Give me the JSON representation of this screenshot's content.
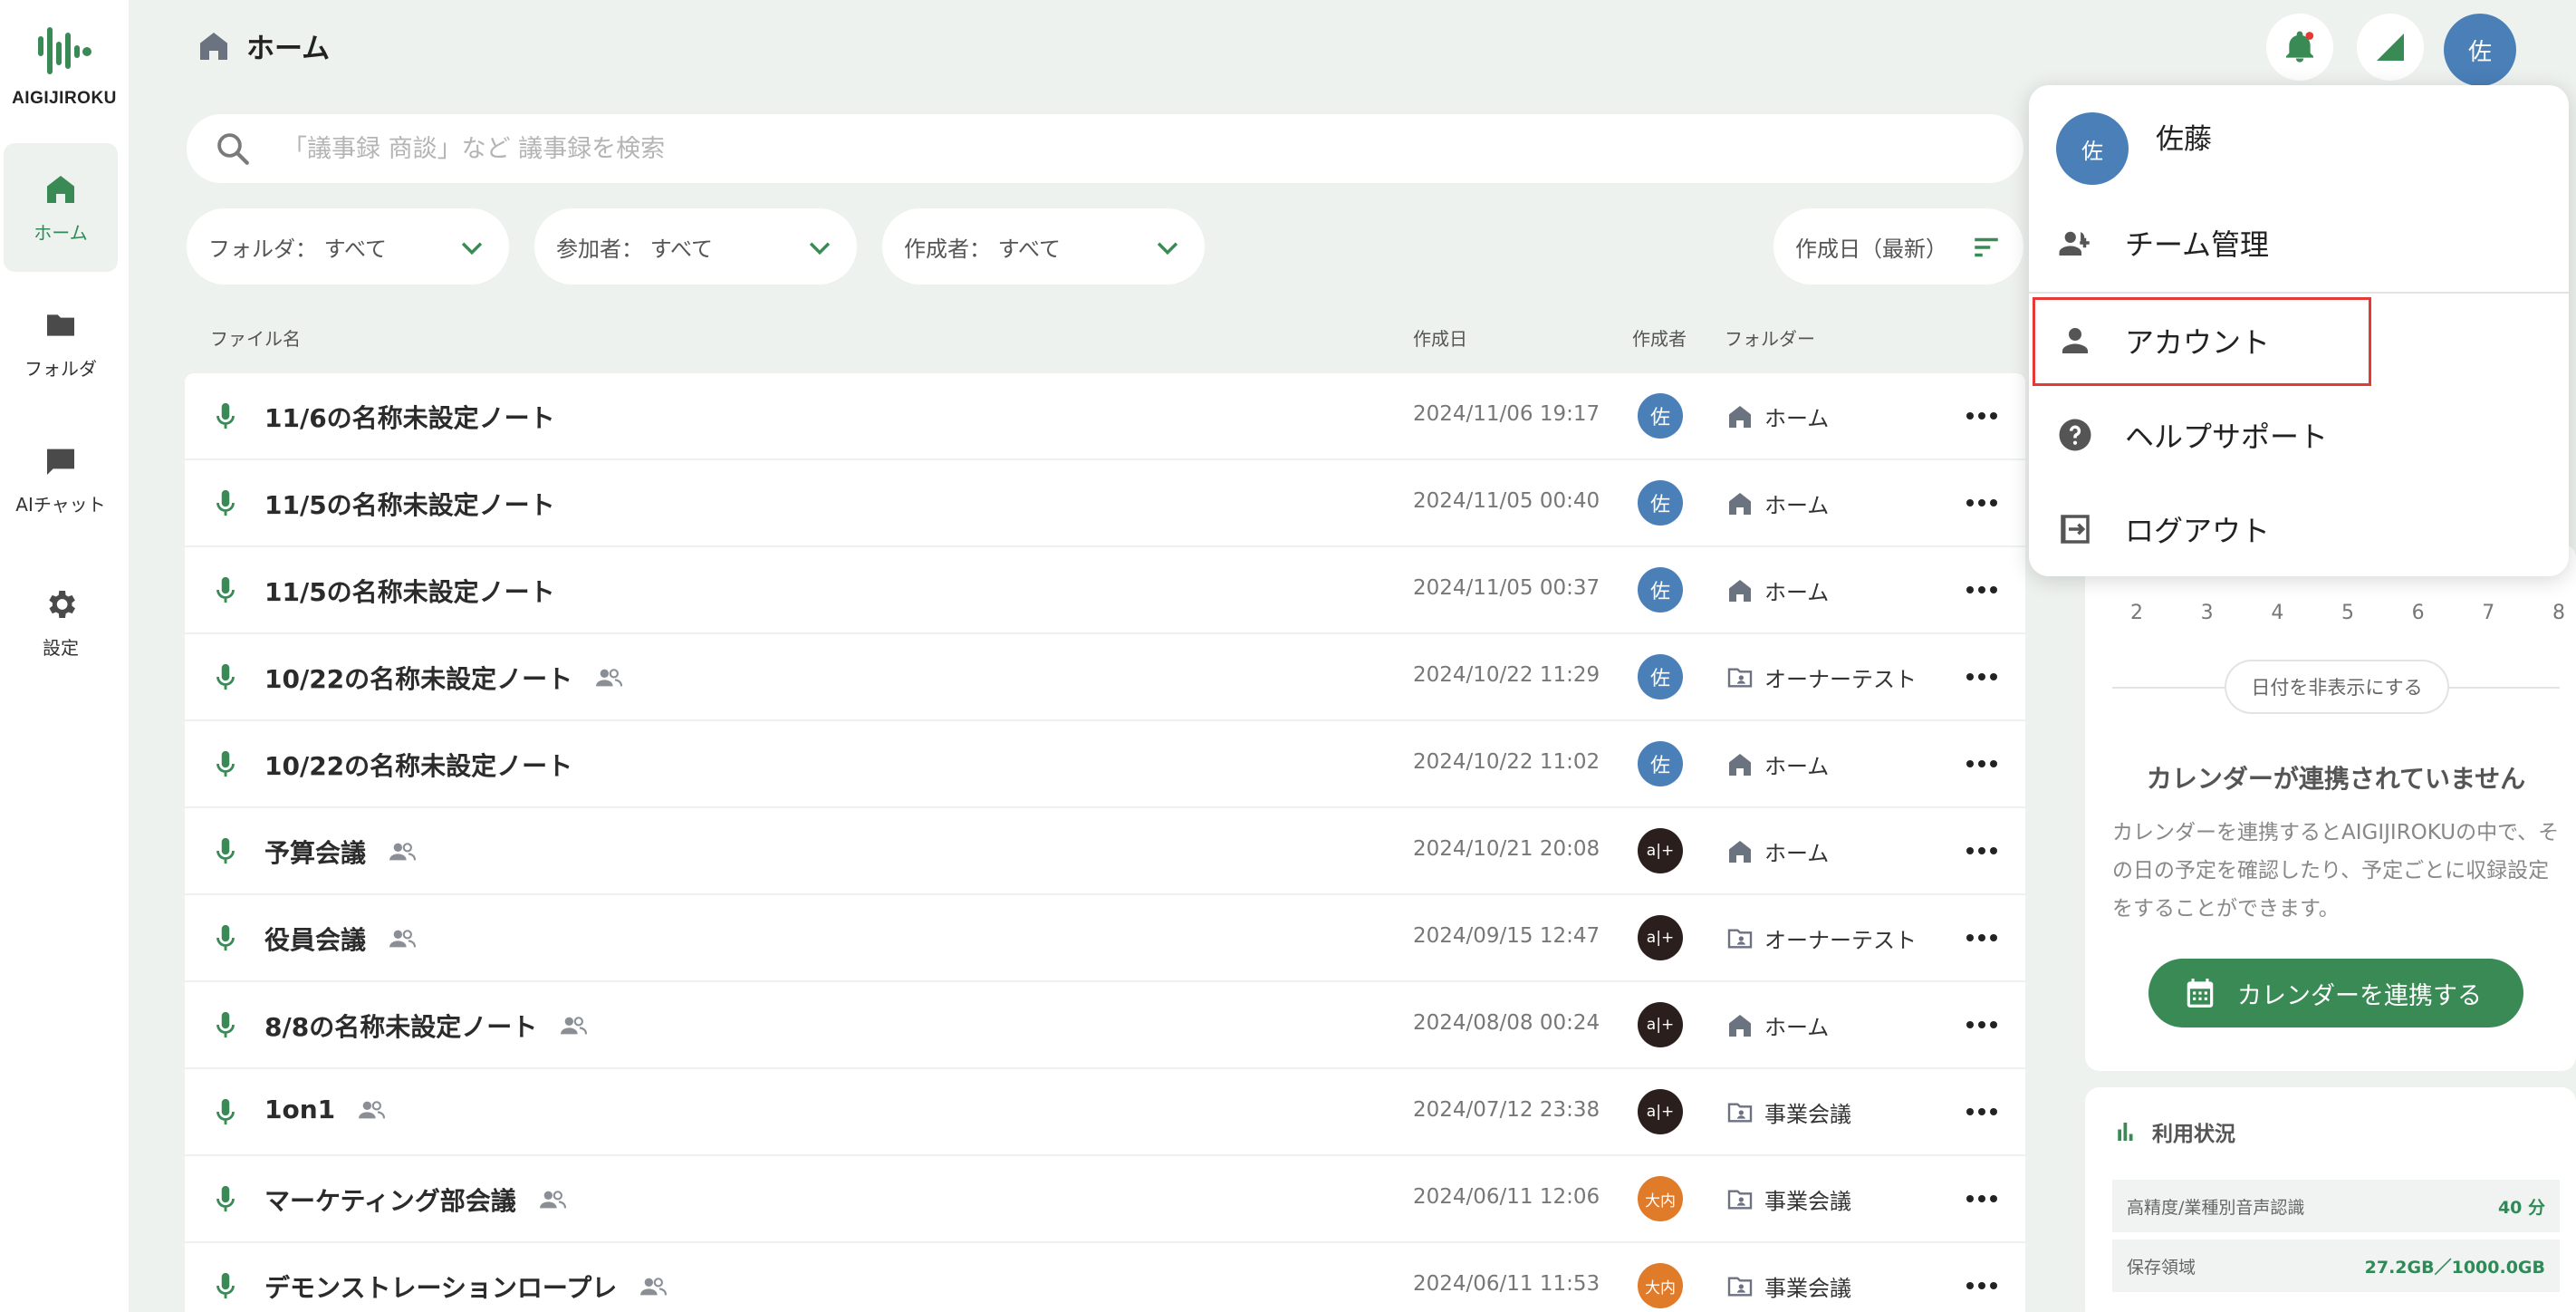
{
  "app": {
    "brand": "AIGIJIROKU",
    "brand_color": "#2e8b57"
  },
  "sidebar": {
    "items": [
      {
        "label": "ホーム",
        "icon": "home-icon",
        "active": true
      },
      {
        "label": "フォルダ",
        "icon": "folder-icon",
        "active": false
      },
      {
        "label": "AIチャット",
        "icon": "chat-icon",
        "active": false
      },
      {
        "label": "設定",
        "icon": "gear-icon",
        "active": false
      }
    ]
  },
  "header": {
    "title": "ホーム",
    "avatar_initial": "佐"
  },
  "search": {
    "placeholder": "「議事録 商談」など 議事録を検索"
  },
  "filters": {
    "folder": "フォルダ： すべて",
    "participant": "参加者： すべて",
    "creator": "作成者： すべて",
    "sort": "作成日（最新）"
  },
  "table": {
    "headers": {
      "name": "ファイル名",
      "date": "作成日",
      "creator": "作成者",
      "folder": "フォルダー"
    },
    "rows": [
      {
        "name": "11/6の名称未設定ノート",
        "shared": false,
        "date": "2024/11/06 19:17",
        "creator": "佐",
        "creator_color": "#4a7fb8",
        "folder": "ホーム",
        "folder_icon": "home-icon"
      },
      {
        "name": "11/5の名称未設定ノート",
        "shared": false,
        "date": "2024/11/05 00:40",
        "creator": "佐",
        "creator_color": "#4a7fb8",
        "folder": "ホーム",
        "folder_icon": "home-icon"
      },
      {
        "name": "11/5の名称未設定ノート",
        "shared": false,
        "date": "2024/11/05 00:37",
        "creator": "佐",
        "creator_color": "#4a7fb8",
        "folder": "ホーム",
        "folder_icon": "home-icon"
      },
      {
        "name": "10/22の名称未設定ノート",
        "shared": true,
        "date": "2024/10/22 11:29",
        "creator": "佐",
        "creator_color": "#4a7fb8",
        "folder": "オーナーテスト",
        "folder_icon": "shared-folder-icon"
      },
      {
        "name": "10/22の名称未設定ノート",
        "shared": false,
        "date": "2024/10/22 11:02",
        "creator": "佐",
        "creator_color": "#4a7fb8",
        "folder": "ホーム",
        "folder_icon": "home-icon"
      },
      {
        "name": "予算会議",
        "shared": true,
        "date": "2024/10/21 20:08",
        "creator": "a|+",
        "creator_color": "#2a1f1c",
        "folder": "ホーム",
        "folder_icon": "home-icon"
      },
      {
        "name": "役員会議",
        "shared": true,
        "date": "2024/09/15 12:47",
        "creator": "a|+",
        "creator_color": "#2a1f1c",
        "folder": "オーナーテスト",
        "folder_icon": "shared-folder-icon"
      },
      {
        "name": "8/8の名称未設定ノート",
        "shared": true,
        "date": "2024/08/08 00:24",
        "creator": "a|+",
        "creator_color": "#2a1f1c",
        "folder": "ホーム",
        "folder_icon": "home-icon"
      },
      {
        "name": "1on1",
        "shared": true,
        "date": "2024/07/12 23:38",
        "creator": "a|+",
        "creator_color": "#2a1f1c",
        "folder": "事業会議",
        "folder_icon": "shared-folder-icon"
      },
      {
        "name": "マーケティング部会議",
        "shared": true,
        "date": "2024/06/11 12:06",
        "creator": "大内",
        "creator_color": "#e07b2a",
        "folder": "事業会議",
        "folder_icon": "shared-folder-icon"
      },
      {
        "name": "デモンストレーションロープレ",
        "shared": true,
        "date": "2024/06/11 11:53",
        "creator": "大内",
        "creator_color": "#e07b2a",
        "folder": "事業会議",
        "folder_icon": "shared-folder-icon"
      }
    ]
  },
  "calendar": {
    "days": [
      "2",
      "3",
      "4",
      "5",
      "6",
      "7",
      "8"
    ],
    "hide_button": "日付を非表示にする",
    "title": "カレンダーが連携されていません",
    "description": "カレンダーを連携するとAIGIJIROKUの中で、その日の予定を確認したり、予定ごとに収録設定をすることができます。",
    "connect_button": "カレンダーを連携する"
  },
  "usage": {
    "title": "利用状況",
    "rows": [
      {
        "label": "高精度/業種別音声認識",
        "value": "40 分"
      },
      {
        "label": "保存領域",
        "value": "27.2GB／1000.0GB"
      }
    ]
  },
  "account_menu": {
    "user_name": "佐藤",
    "avatar_initial": "佐",
    "items": [
      {
        "label": "チーム管理",
        "icon": "team-add-icon"
      },
      {
        "label": "アカウント",
        "icon": "person-icon",
        "highlighted": true
      },
      {
        "label": "ヘルプサポート",
        "icon": "help-icon"
      },
      {
        "label": "ログアウト",
        "icon": "logout-icon"
      }
    ]
  }
}
